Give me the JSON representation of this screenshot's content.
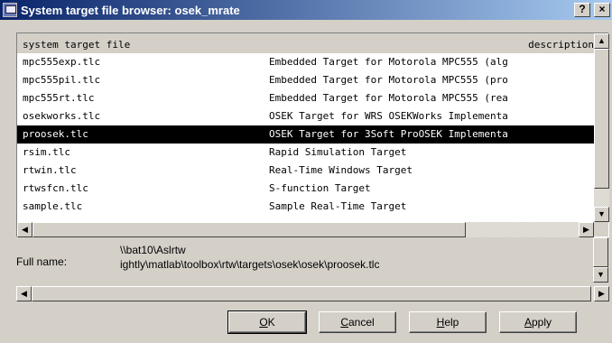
{
  "window": {
    "title": "System target file browser: osek_mrate",
    "help_button": "?",
    "close_button": "×"
  },
  "list": {
    "header_left": "system target file",
    "header_right": "description",
    "rows": [
      {
        "file": "mpc555exp.tlc",
        "description": "Embedded Target for Motorola MPC555 (alg"
      },
      {
        "file": "mpc555pil.tlc",
        "description": "Embedded Target for Motorola MPC555 (pro"
      },
      {
        "file": "mpc555rt.tlc",
        "description": "Embedded Target for Motorola MPC555 (rea"
      },
      {
        "file": "osekworks.tlc",
        "description": "OSEK Target for WRS OSEKWorks Implementa"
      },
      {
        "file": "proosek.tlc",
        "description": "OSEK Target for 3Soft ProOSEK Implementa"
      },
      {
        "file": "rsim.tlc",
        "description": "Rapid Simulation Target"
      },
      {
        "file": "rtwin.tlc",
        "description": "Real-Time Windows Target"
      },
      {
        "file": "rtwsfcn.tlc",
        "description": "S-function Target"
      },
      {
        "file": "sample.tlc",
        "description": "Sample Real-Time Target"
      }
    ],
    "selected_index": 4
  },
  "full_name": {
    "label": "Full name:",
    "line1": "\\\\bat10\\Aslrtw",
    "line2": "ightly\\matlab\\toolbox\\rtw\\targets\\osek\\osek\\proosek.tlc"
  },
  "buttons": {
    "ok": "OK",
    "cancel": "Cancel",
    "help": "Help",
    "apply": "Apply"
  }
}
